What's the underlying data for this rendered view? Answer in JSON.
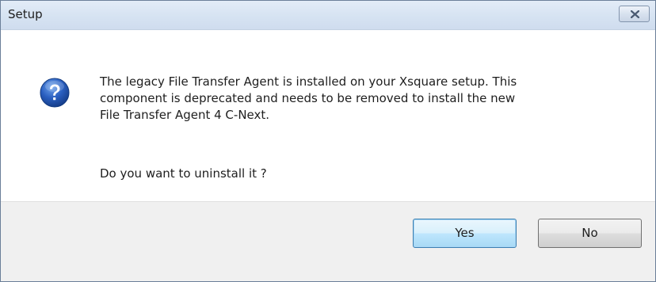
{
  "window": {
    "title": "Setup",
    "close_icon": "close-icon"
  },
  "dialog": {
    "icon": "question-icon",
    "message_lines": [
      "The legacy File Transfer Agent is installed on your Xsquare setup. This",
      "component is deprecated and needs to be removed to install the new",
      "File Transfer Agent 4 C-Next."
    ],
    "question": "Do you want to uninstall it ?"
  },
  "buttons": {
    "yes_label": "Yes",
    "no_label": "No"
  },
  "colors": {
    "icon_blue": "#1f4fa8",
    "titlebar": "#d6e3f2",
    "footer": "#f0f0f0"
  }
}
